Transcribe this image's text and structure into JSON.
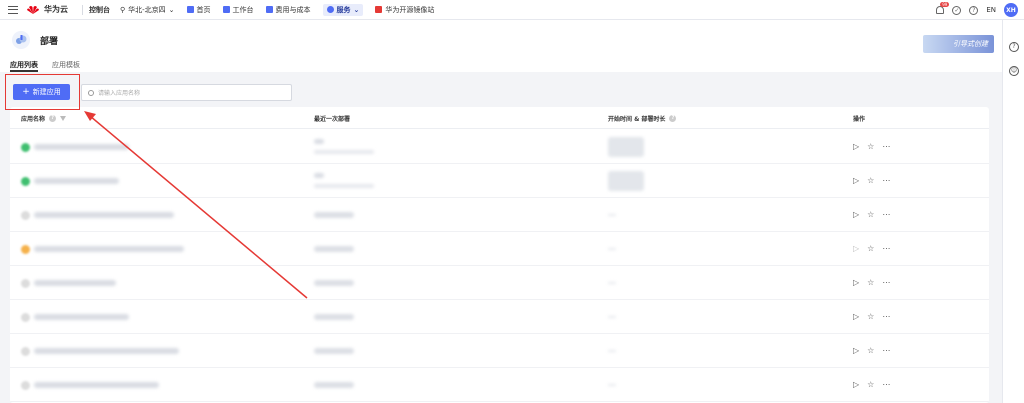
{
  "topbar": {
    "brand": "华为云",
    "console": "控制台",
    "region": "华北-北京四",
    "nav": [
      {
        "label": "首页"
      },
      {
        "label": "工作台"
      },
      {
        "label": "费用与成本"
      },
      {
        "label": "服务"
      },
      {
        "label": "华为开源镜像站"
      }
    ],
    "badge": "99",
    "lang": "EN",
    "avatar": "XH"
  },
  "page": {
    "title": "部署",
    "guide_button": "引导式创建",
    "tabs": [
      {
        "label": "应用列表",
        "active": true
      },
      {
        "label": "应用模板",
        "active": false
      }
    ]
  },
  "toolbar": {
    "create_button": "新建应用",
    "search_placeholder": "请输入应用名称"
  },
  "table": {
    "headers": [
      {
        "label": "应用名称"
      },
      {
        "label": "最近一次部署"
      },
      {
        "label": "开始时间 & 部署时长"
      },
      {
        "label": "操作"
      }
    ],
    "rows": [
      {
        "status": "#3fbf6f",
        "actions_enabled": true
      },
      {
        "status": "#3fbf6f",
        "actions_enabled": true
      },
      {
        "status": "#dcdcdc",
        "actions_enabled": true
      },
      {
        "status": "#f5b14a",
        "actions_enabled": false
      },
      {
        "status": "#dcdcdc",
        "actions_enabled": true
      },
      {
        "status": "#dcdcdc",
        "actions_enabled": true
      },
      {
        "status": "#dcdcdc",
        "actions_enabled": true
      },
      {
        "status": "#dcdcdc",
        "actions_enabled": true
      }
    ]
  },
  "colors": {
    "primary": "#4f6cf5",
    "annotation": "#e53935"
  }
}
